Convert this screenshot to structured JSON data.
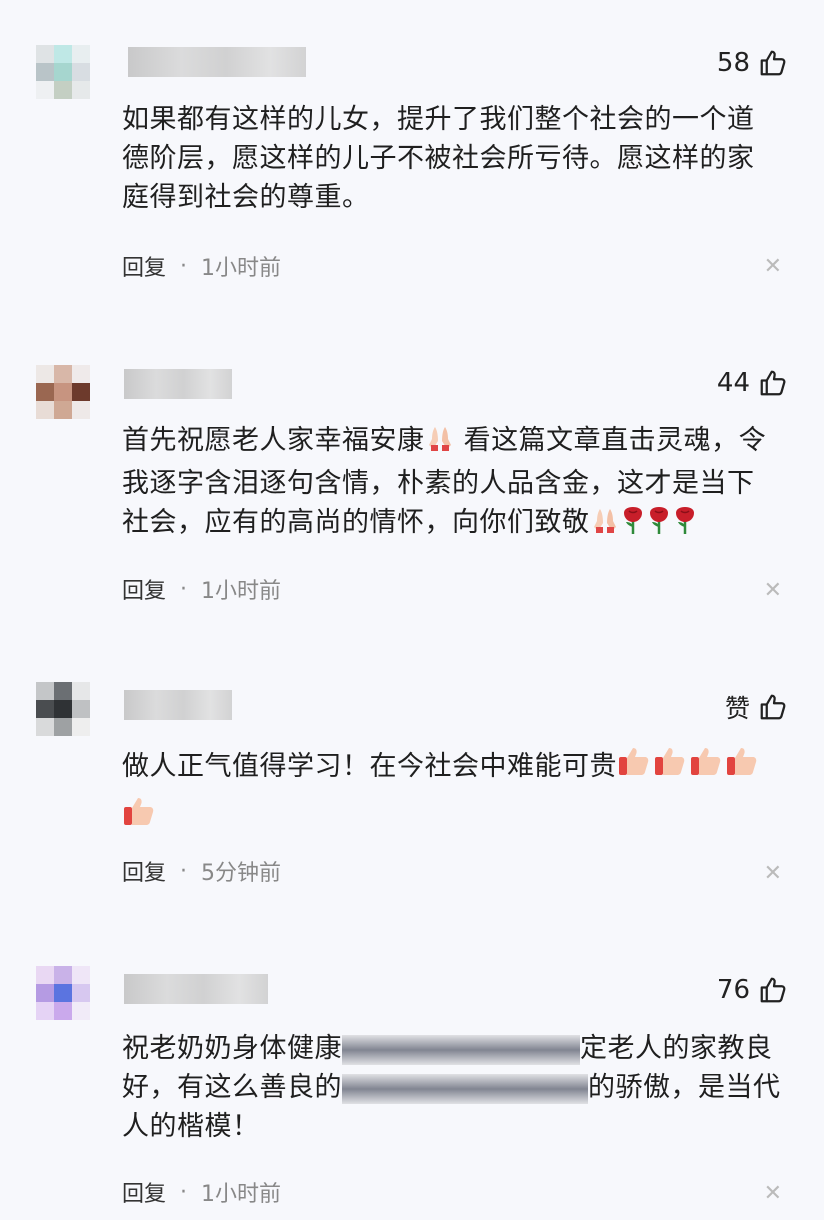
{
  "comments": [
    {
      "likes": "58",
      "text_lines": [
        "如果都有这样的儿女，提升了我们整个社会的一个道",
        "德阶层，愿这样的儿子不被社会所亏待。愿这样的家",
        "庭得到社会的尊重。"
      ],
      "reply": "回复",
      "time": "1小时前",
      "avatar_colors": [
        "#dfe3e5",
        "#bfe8e6",
        "#e8eef0",
        "#b9c4c8",
        "#a6d6cf",
        "#d8dde2",
        "#eef0f2",
        "#c4cfc3",
        "#e6e9ea"
      ]
    },
    {
      "likes": "44",
      "text_lines": [
        "首先祝愿老人家幸福安康",
        " 看这篇文章直击灵魂，令",
        "我逐字含泪逐句含情，朴素的人品含金，这才是当下",
        "社会，应有的高尚的情怀，向你们致敬"
      ],
      "reply": "回复",
      "time": "1小时前",
      "avatar_colors": [
        "#ede8e6",
        "#d8b7a8",
        "#efeaea",
        "#9a6751",
        "#c79480",
        "#6d3a2c",
        "#e8dcd6",
        "#cfa894",
        "#eee9e8"
      ]
    },
    {
      "likes": "赞",
      "text_lines": [
        "做人正气值得学习！在今社会中难能可贵"
      ],
      "reply": "回复",
      "time": "5分钟前",
      "avatar_colors": [
        "#c4c6c8",
        "#6b6f73",
        "#e6e7e8",
        "#4a4d50",
        "#2f3235",
        "#bfc1c3",
        "#d9dadb",
        "#9ea1a3",
        "#eeeeee"
      ]
    },
    {
      "likes": "76",
      "text_lines": [
        "祝老奶奶身体健康",
        "定老人的家教良",
        "好，有这么善良的",
        "的骄傲，是当代",
        "人的楷模！"
      ],
      "reply": "回复",
      "time": "1小时前",
      "avatar_colors": [
        "#e9d8f3",
        "#c9b2e8",
        "#efe6f7",
        "#b59be3",
        "#5b74e0",
        "#d7c8f0",
        "#e5d3f5",
        "#caa9ec",
        "#f1ebf8"
      ]
    }
  ],
  "icons": {
    "like": "thumbs-up-icon",
    "close": "close-icon",
    "pray": "pray-emoji",
    "rose": "rose-emoji",
    "thumb": "thumbs-up-emoji"
  }
}
